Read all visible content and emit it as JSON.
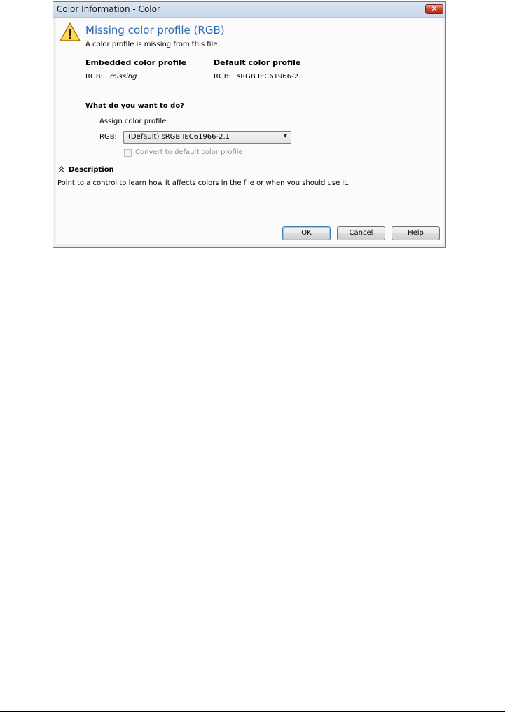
{
  "window": {
    "title": "Color Information - Color",
    "close_glyph": "✕"
  },
  "header": {
    "icon": "warning-icon",
    "title": "Missing color profile (RGB)",
    "subtitle": "A color profile is missing from this file."
  },
  "profiles": {
    "embedded": {
      "heading": "Embedded color profile",
      "channel": "RGB:",
      "value": "missing"
    },
    "default": {
      "heading": "Default color profile",
      "channel": "RGB:",
      "value": "sRGB IEC61966-2.1"
    }
  },
  "action": {
    "question": "What do you want to do?",
    "assign_label": "Assign color profile:",
    "rgb_label": "RGB:",
    "selected_profile": "(Default) sRGB IEC61966-2.1",
    "convert_label": "Convert to default color profile",
    "convert_checked": false,
    "convert_enabled": false
  },
  "description": {
    "collapse_icon": "double-chevron-up-icon",
    "title": "Description",
    "text": "Point to a control to learn how it affects colors in the file or when you should use it."
  },
  "buttons": {
    "ok": "OK",
    "cancel": "Cancel",
    "help": "Help"
  }
}
